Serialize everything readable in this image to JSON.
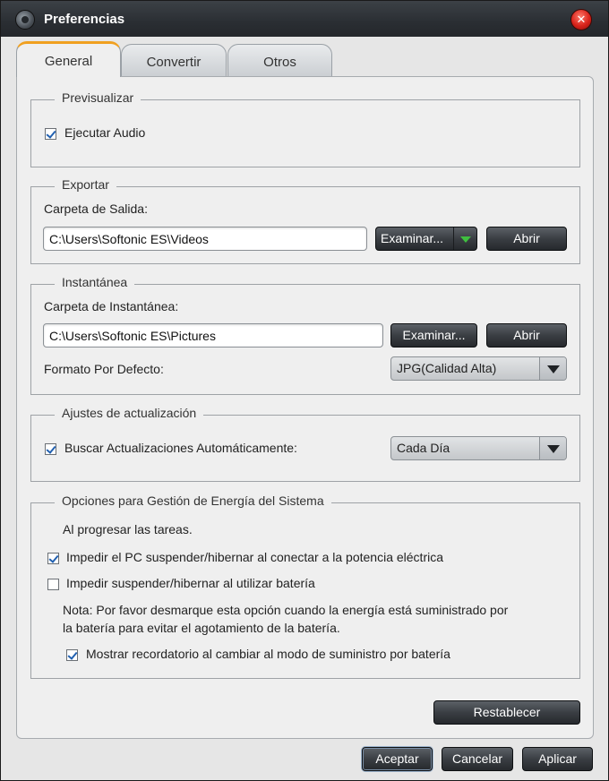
{
  "window": {
    "title": "Preferencias"
  },
  "tabs": [
    {
      "label": "General"
    },
    {
      "label": "Convertir"
    },
    {
      "label": "Otros"
    }
  ],
  "preview": {
    "legend": "Previsualizar",
    "play_audio_label": "Ejecutar Audio",
    "play_audio_checked": true
  },
  "export": {
    "legend": "Exportar",
    "folder_label": "Carpeta de Salida:",
    "folder_value": "C:\\Users\\Softonic ES\\Videos",
    "browse_label": "Examinar...",
    "open_label": "Abrir"
  },
  "snapshot": {
    "legend": "Instantánea",
    "folder_label": "Carpeta de Instantánea:",
    "folder_value": "C:\\Users\\Softonic ES\\Pictures",
    "browse_label": "Examinar...",
    "open_label": "Abrir",
    "format_label": "Formato Por Defecto:",
    "format_value": "JPG(Calidad Alta)"
  },
  "updates": {
    "legend": "Ajustes de actualización",
    "auto_label": "Buscar Actualizaciones Automáticamente:",
    "auto_checked": true,
    "frequency_value": "Cada Día"
  },
  "power": {
    "legend": "Opciones para Gestión de Energía del Sistema",
    "intro": "Al progresar las tareas.",
    "prevent_ac_label": "Impedir el PC suspender/hibernar al conectar a la potencia eléctrica",
    "prevent_ac_checked": true,
    "prevent_battery_label": "Impedir  suspender/hibernar al utilizar batería",
    "prevent_battery_checked": false,
    "note_line1": "Nota: Por favor desmarque esta opción cuando la energía está suministrado por",
    "note_line2": "la batería para evitar el agotamiento de la batería.",
    "reminder_label": "Mostrar recordatorio al cambiar al modo de suministro por batería",
    "reminder_checked": true
  },
  "actions": {
    "reset_label": "Restablecer",
    "ok_label": "Aceptar",
    "cancel_label": "Cancelar",
    "apply_label": "Aplicar"
  },
  "colors": {
    "titlebar": "#2a2e33",
    "active_tab_accent": "#f0a020",
    "button_dark": "#3a3e43",
    "close_red": "#d8221a",
    "split_arrow_green": "#3fbf3f"
  }
}
